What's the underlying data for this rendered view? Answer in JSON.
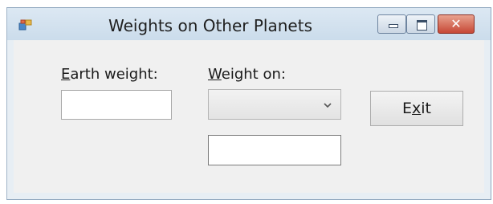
{
  "window": {
    "title": "Weights on Other Planets",
    "icon": "app-window-icon",
    "controls": {
      "minimize": "minimize-icon",
      "maximize": "maximize-icon",
      "close": "close-icon",
      "close_glyph": "✕"
    }
  },
  "form": {
    "earth_label_access": "E",
    "earth_label_rest": "arth weight:",
    "earth_input_value": "",
    "weight_on_label_access": "W",
    "weight_on_label_rest": "eight on:",
    "planet_select_value": "",
    "result_value": "",
    "exit_before": "E",
    "exit_access": "x",
    "exit_after": "it"
  },
  "colors": {
    "titlebar": "#d6e4f0",
    "client": "#f0f0f0",
    "close": "#c64836"
  }
}
